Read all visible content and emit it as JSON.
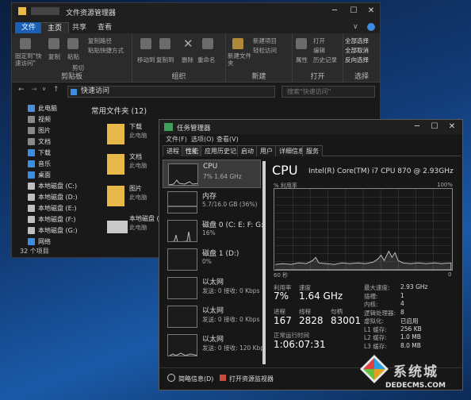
{
  "explorer": {
    "title": "文件资源管理器",
    "tabs": [
      "文件",
      "主页",
      "共享",
      "查看"
    ],
    "active_tab": "主页",
    "ribbon": {
      "clipboard": {
        "label": "剪贴板",
        "pin": "固定到\"快速访问\"",
        "copy": "复制",
        "paste": "粘贴",
        "copy_path": "复制路径",
        "paste_shortcut": "粘贴快捷方式",
        "cut": "剪切"
      },
      "organize": {
        "label": "组织",
        "move_to": "移动到",
        "copy_to": "复制到",
        "delete": "删除",
        "rename": "重命名"
      },
      "new": {
        "label": "新建",
        "new_folder": "新建文件夹",
        "new_item": "新建项目",
        "easy_access": "轻松访问"
      },
      "open": {
        "label": "打开",
        "properties": "属性",
        "open": "打开",
        "edit": "编辑",
        "history": "历史记录"
      },
      "select": {
        "label": "选择",
        "select_all": "全部选择",
        "select_none": "全部取消",
        "invert": "反向选择"
      }
    },
    "address": "快速访问",
    "search_placeholder": "搜索\"快速访问\"",
    "nav": [
      {
        "label": "此电脑",
        "color": "#4a90d9"
      },
      {
        "label": "视频",
        "color": "#8a8a8a"
      },
      {
        "label": "图片",
        "color": "#8a8a8a"
      },
      {
        "label": "文档",
        "color": "#8a8a8a"
      },
      {
        "label": "下载",
        "color": "#3d8de0"
      },
      {
        "label": "音乐",
        "color": "#3d8de0"
      },
      {
        "label": "桌面",
        "color": "#3d8de0"
      },
      {
        "label": "本地磁盘 (C:)",
        "color": "#bfbfbf"
      },
      {
        "label": "本地磁盘 (D:)",
        "color": "#bfbfbf"
      },
      {
        "label": "本地磁盘 (E:)",
        "color": "#bfbfbf"
      },
      {
        "label": "本地磁盘 (F:)",
        "color": "#bfbfbf"
      },
      {
        "label": "本地磁盘 (G:)",
        "color": "#bfbfbf"
      },
      {
        "label": "网络",
        "color": "#3d8de0"
      }
    ],
    "section_header": "常用文件夹 (12)",
    "folders": [
      {
        "name": "下载",
        "sub": "此电脑"
      },
      {
        "name": "文档",
        "sub": "此电脑"
      },
      {
        "name": "图片",
        "sub": "此电脑"
      },
      {
        "name": "本地磁盘 (G:)",
        "sub": "此电脑"
      }
    ],
    "status": "32 个项目"
  },
  "taskmgr": {
    "title": "任务管理器",
    "menu": [
      "文件(F)",
      "选项(O)",
      "查看(V)"
    ],
    "tabs": [
      "进程",
      "性能",
      "应用历史记录",
      "启动",
      "用户",
      "详细信息",
      "服务"
    ],
    "active_tab": "性能",
    "sidebar": [
      {
        "name": "CPU",
        "sub": "7% 1.64 GHz"
      },
      {
        "name": "内存",
        "sub": "5.7/16.0 GB (36%)"
      },
      {
        "name": "磁盘 0 (C: E: F: G:",
        "sub": "16%"
      },
      {
        "name": "磁盘 1 (D:)",
        "sub": "0%"
      },
      {
        "name": "以太网",
        "sub": "发送: 0 接收: 0 Kbps"
      },
      {
        "name": "以太网",
        "sub": "发送: 0 接收: 0 Kbps"
      },
      {
        "name": "以太网",
        "sub": "发送: 0 接收: 120 Kbp"
      }
    ],
    "cpu_title": "CPU",
    "cpu_model": "Intel(R) Core(TM) i7 CPU 870 @ 2.93GHz",
    "graph_label_left": "% 利用率",
    "graph_label_right": "100%",
    "graph_bottom_left": "60 秒",
    "graph_bottom_right": "0",
    "stats": {
      "utilization_label": "利用率",
      "utilization": "7%",
      "speed_label": "速度",
      "speed": "1.64 GHz",
      "processes_label": "进程",
      "processes": "167",
      "threads_label": "线程",
      "threads": "2828",
      "handles_label": "句柄",
      "handles": "83001",
      "uptime_label": "正常运行时间",
      "uptime": "1:06:07:31"
    },
    "details": [
      {
        "k": "最大速度:",
        "v": "2.93 GHz"
      },
      {
        "k": "插槽:",
        "v": "1"
      },
      {
        "k": "内核:",
        "v": "4"
      },
      {
        "k": "逻辑处理器:",
        "v": "8"
      },
      {
        "k": "虚拟化:",
        "v": "已启用"
      },
      {
        "k": "L1 缓存:",
        "v": "256 KB"
      },
      {
        "k": "L2 缓存:",
        "v": "1.0 MB"
      },
      {
        "k": "L3 缓存:",
        "v": "8.0 MB"
      }
    ],
    "footer": {
      "fewer": "简略信息(D)",
      "resmon": "打开资源监视器"
    }
  },
  "watermark": {
    "text": "系统城",
    "url": "DEDECMS.COM"
  },
  "colors": {
    "accent": "#3d8de0",
    "folder": "#e8b84a",
    "graph_line": "#bfbfbf"
  }
}
